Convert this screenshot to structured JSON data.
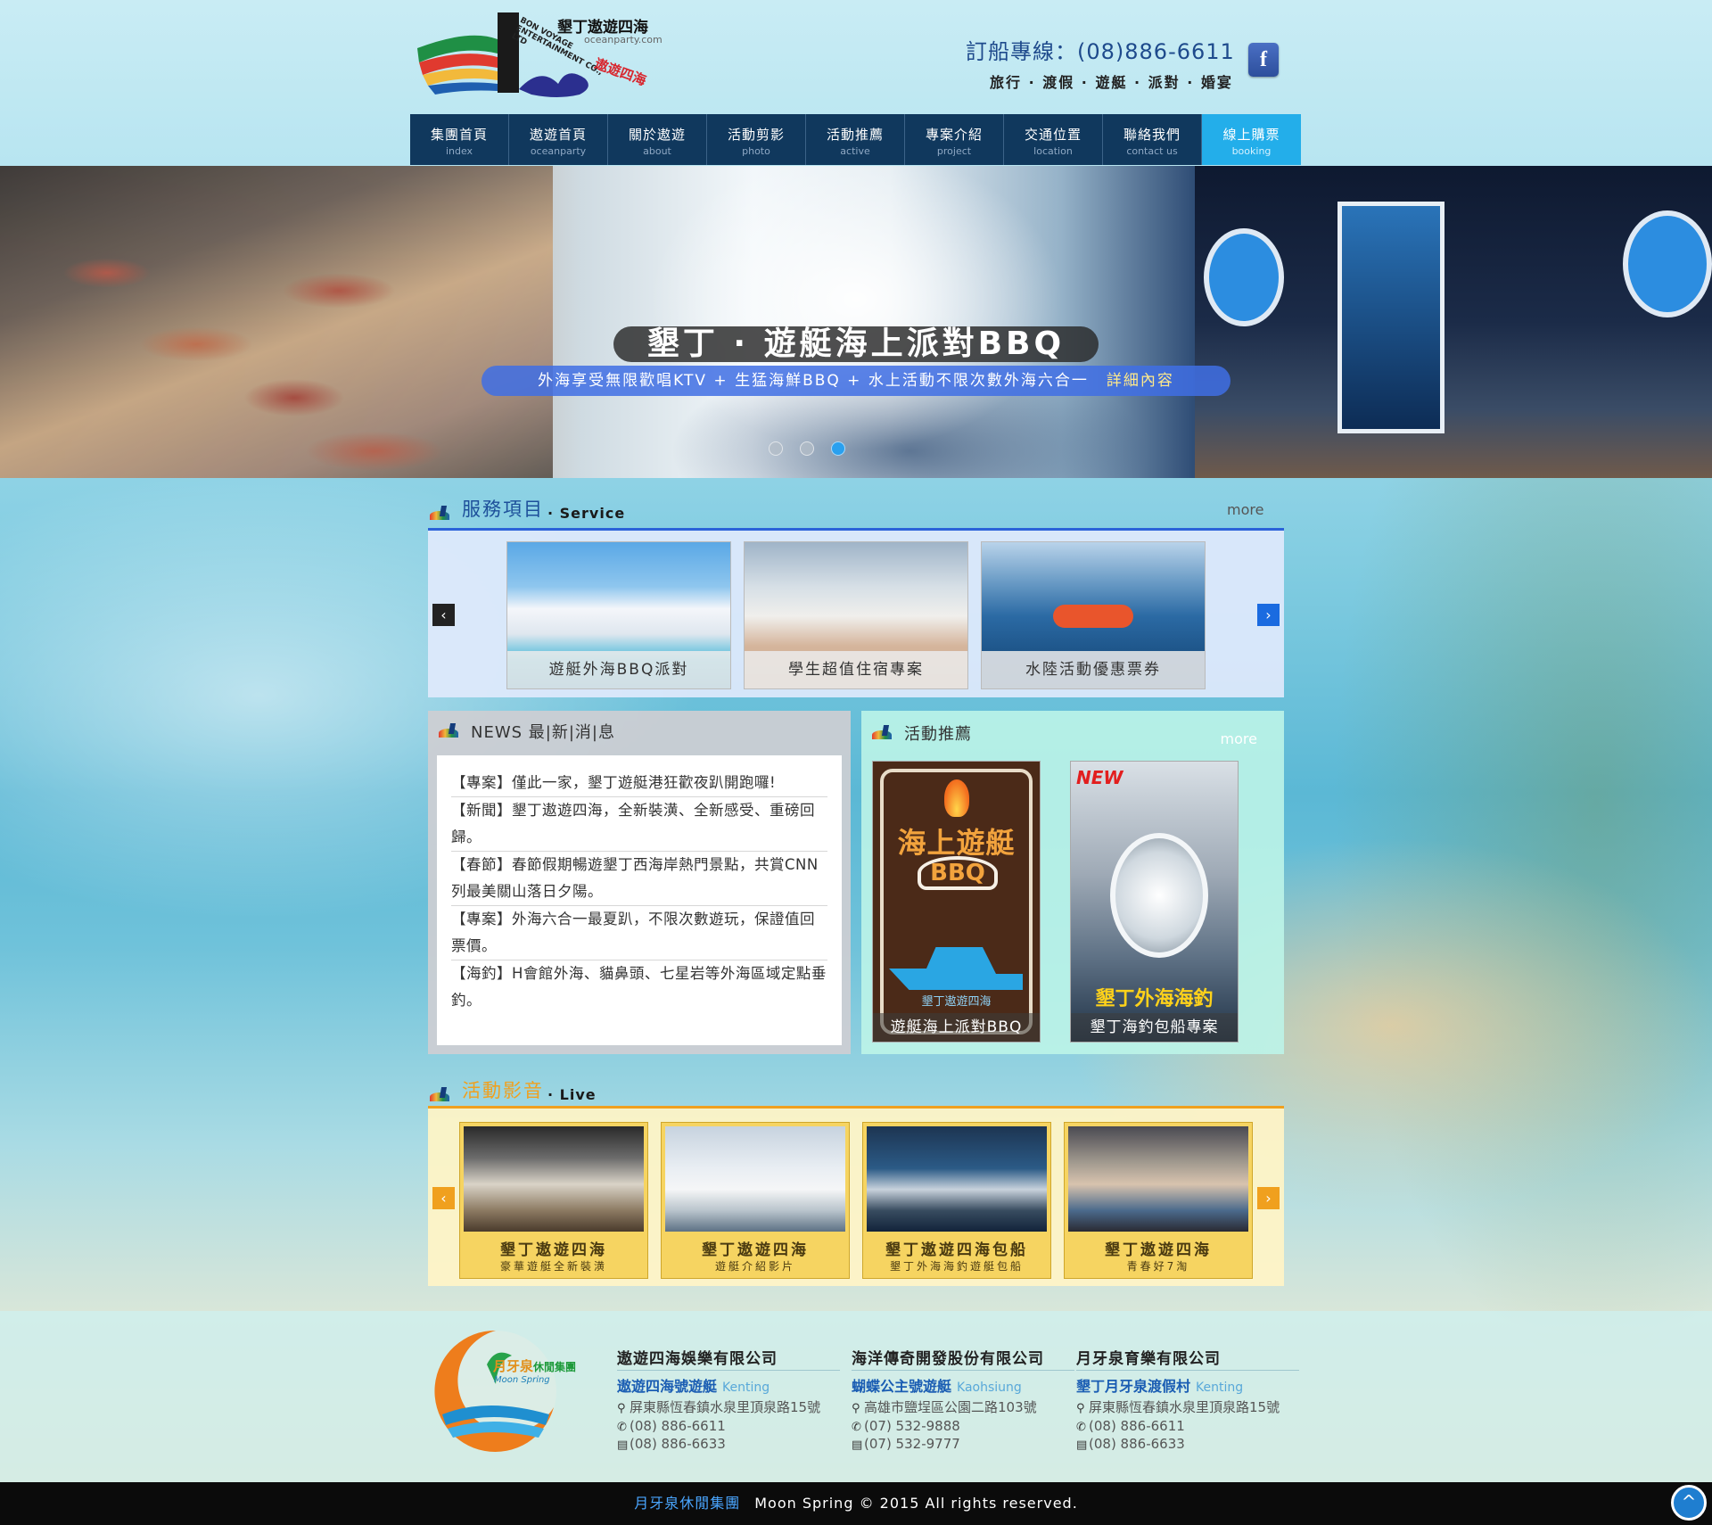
{
  "header": {
    "logo_text": "BON VOYAGE ENTERTAINMENT CO., LTD",
    "logo_cn": "遨遊四海",
    "brand_cn": "墾丁遨遊四海",
    "brand_en": "oceanparty.com",
    "hotline": "訂船專線：(08)886-6611",
    "tagline": "旅行 · 渡假 · 遊艇 · 派對 · 婚宴",
    "facebook": "f"
  },
  "nav": [
    {
      "cn": "集團首頁",
      "en": "index"
    },
    {
      "cn": "遨遊首頁",
      "en": "oceanparty"
    },
    {
      "cn": "關於遨遊",
      "en": "about"
    },
    {
      "cn": "活動剪影",
      "en": "photo"
    },
    {
      "cn": "活動推薦",
      "en": "active"
    },
    {
      "cn": "專案介紹",
      "en": "project"
    },
    {
      "cn": "交通位置",
      "en": "location"
    },
    {
      "cn": "聯絡我們",
      "en": "contact us"
    },
    {
      "cn": "線上購票",
      "en": "booking"
    }
  ],
  "banner": {
    "title": "墾丁 · 遊艇海上派對BBQ",
    "subtitle": "外海享受無限歡唱KTV + 生猛海鮮BBQ + 水上活動不限次數外海六合一",
    "more": "詳細內容",
    "active_slide": 3,
    "slide_count": 3
  },
  "service": {
    "title_cn": "服務項目",
    "title_en": "· Service",
    "more": "more",
    "items": [
      "遊艇外海BBQ派對",
      "學生超值住宿專案",
      "水陸活動優惠票券"
    ],
    "prev": "‹",
    "next": "›"
  },
  "news": {
    "title": "NEWS 最|新|消|息",
    "items": [
      "【專案】僅此一家，墾丁遊艇港狂歡夜趴開跑囉!",
      "【新聞】墾丁遨遊四海，全新裝潢、全新感受、重磅回歸。",
      "【春節】春節假期暢遊墾丁西海岸熱門景點，共賞CNN列最美關山落日夕陽。",
      "【專案】外海六合一最夏趴，不限次數遊玩，保證值回票價。",
      "【海釣】H會館外海、貓鼻頭、七星岩等外海區域定點垂釣。"
    ]
  },
  "activity": {
    "title": "活動推薦",
    "more": "more",
    "cards": [
      {
        "caption": "遊艇海上派對BBQ",
        "art_title": "海上遊艇",
        "art_badge": "BBQ",
        "art_boat": "墾丁遨遊四海"
      },
      {
        "caption": "墾丁海釣包船專案",
        "badge": "NEW",
        "art_title": "墾丁外海海釣"
      }
    ]
  },
  "live": {
    "title_cn": "活動影音",
    "title_en": "· Live",
    "items": [
      {
        "title": "墾丁遨遊四海",
        "sub": "豪華遊艇全新裝潢"
      },
      {
        "title": "墾丁遨遊四海",
        "sub": "遊艇介紹影片"
      },
      {
        "title": "墾丁遨遊四海包船",
        "sub": "墾丁外海海釣遊艇包船"
      },
      {
        "title": "墾丁遨遊四海",
        "sub": "青春好7淘"
      }
    ],
    "prev": "‹",
    "next": "›"
  },
  "footer": {
    "group_logo_cn": "月牙泉",
    "group_logo_cn2": "休閒集團",
    "group_logo_en": "Moon Spring",
    "companies": [
      {
        "name": "遨遊四海娛樂有限公司",
        "brand": "遨遊四海號遊艇",
        "region": "Kenting",
        "address": "屏東縣恆春鎮水泉里頂泉路15號",
        "phone": "(08) 886-6611",
        "fax": "(08) 886-6633"
      },
      {
        "name": "海洋傳奇開發股份有限公司",
        "brand": "蝴蝶公主號遊艇",
        "region": "Kaohsiung",
        "address": "高雄市鹽埕區公園二路103號",
        "phone": "(07) 532-9888",
        "fax": "(07) 532-9777"
      },
      {
        "name": "月牙泉育樂有限公司",
        "brand": "墾丁月牙泉渡假村",
        "region": "Kenting",
        "address": "屏東縣恆春鎮水泉里頂泉路15號",
        "phone": "(08) 886-6611",
        "fax": "(08) 886-6633"
      }
    ],
    "copyright_group": "月牙泉休閒集團",
    "copyright": "Moon Spring © 2015 All rights reserved.",
    "totop": "^"
  },
  "colors": {
    "nav_bg": "#10385d",
    "nav_active": "#23aeea",
    "service_accent": "#2b62d9",
    "live_accent": "#f0a01e"
  }
}
